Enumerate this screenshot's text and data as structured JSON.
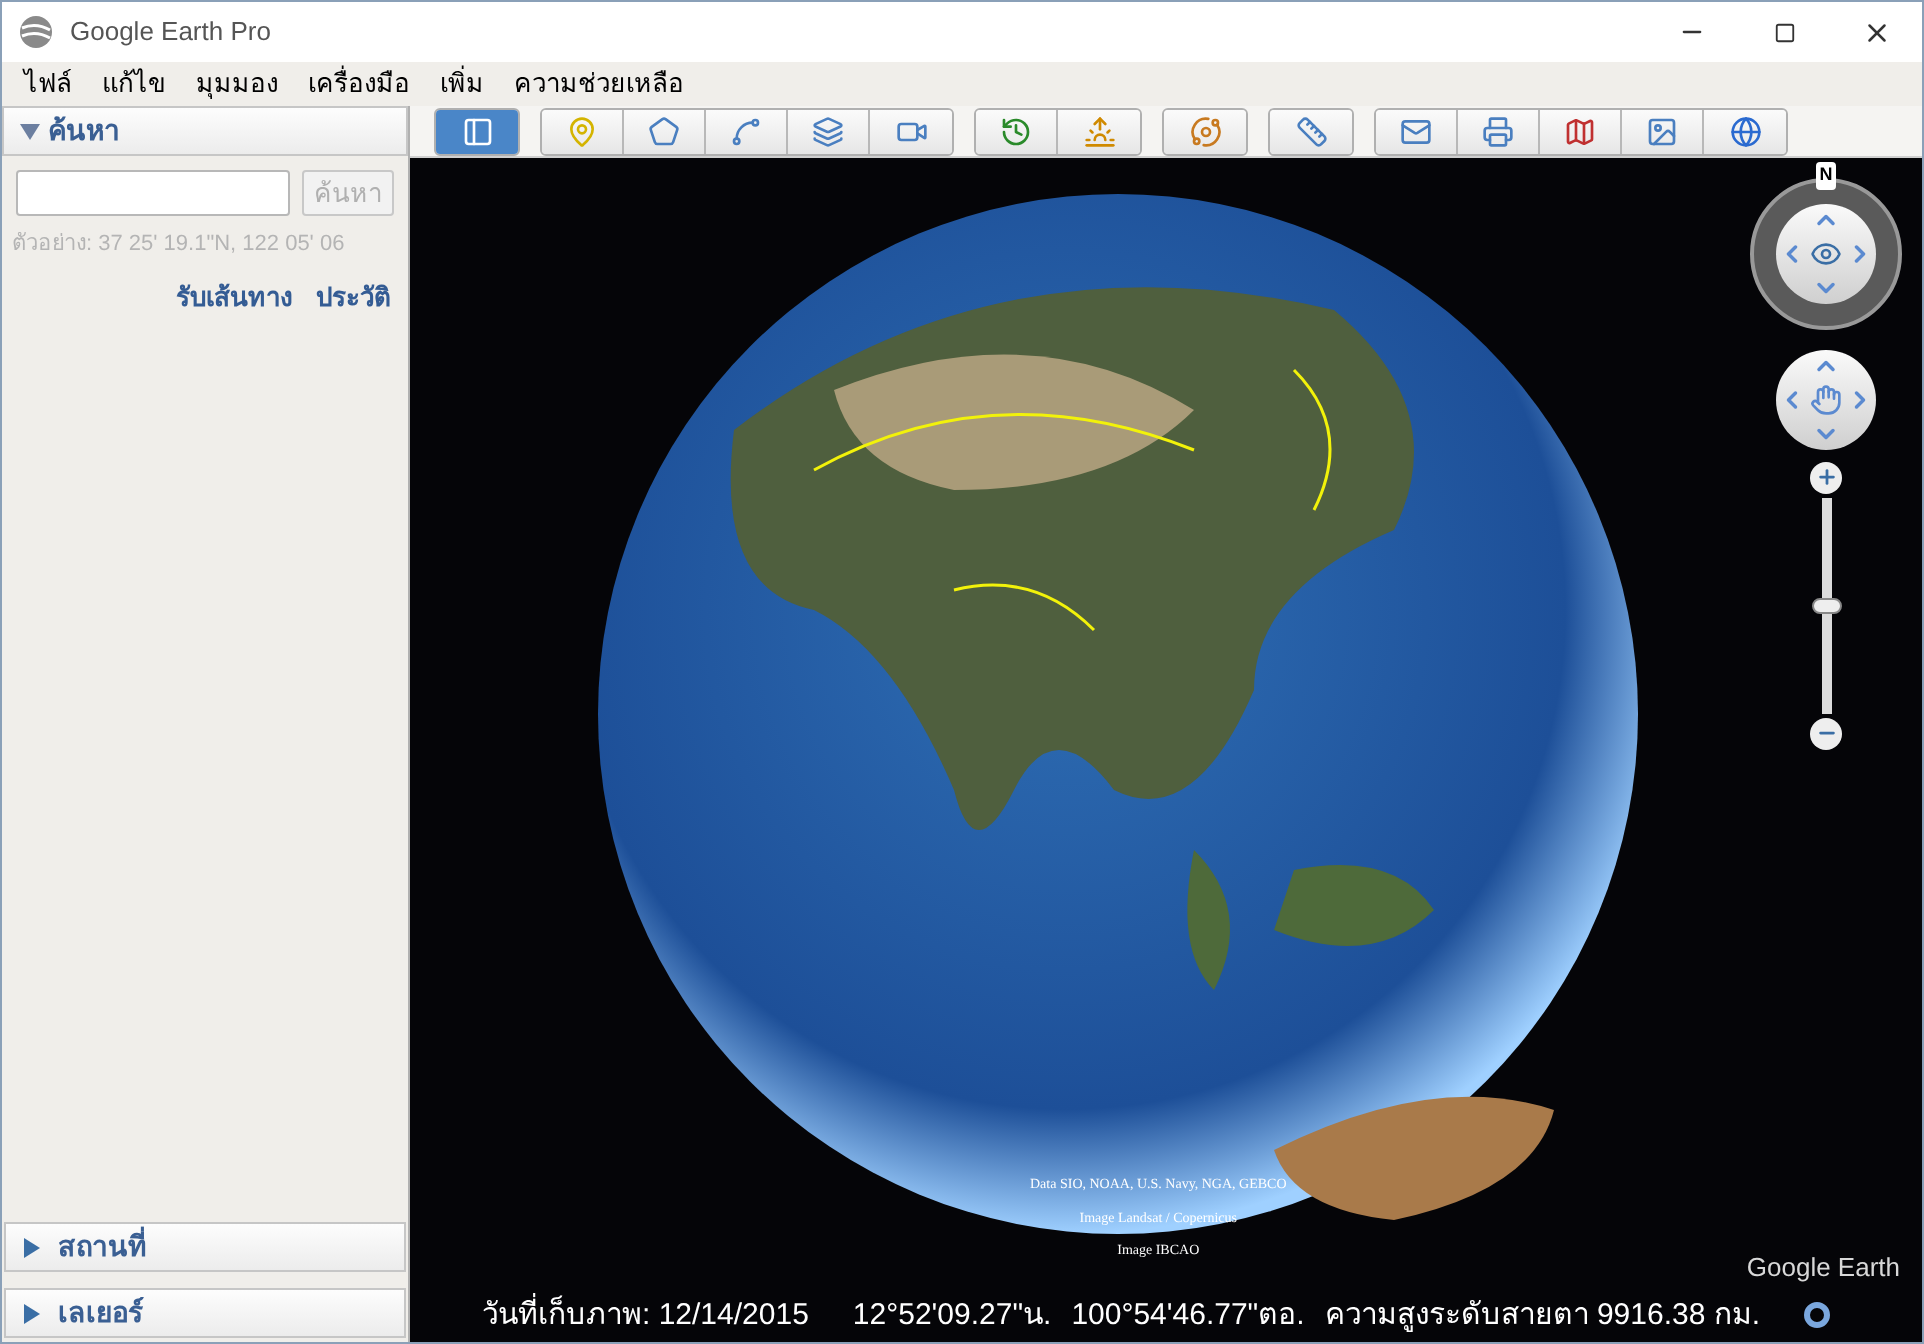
{
  "window": {
    "title": "Google Earth Pro"
  },
  "menu": [
    "ไฟล์",
    "แก้ไข",
    "มุมมอง",
    "เครื่องมือ",
    "เพิ่ม",
    "ความช่วยเหลือ"
  ],
  "search_panel": {
    "title": "ค้นหา",
    "expanded": true,
    "button": "ค้นหา",
    "example": "ตัวอย่าง: 37 25' 19.1\"N, 122 05' 06",
    "links": [
      "รับเส้นทาง",
      "ประวัติ"
    ]
  },
  "bottom_panels": [
    {
      "title": "สถานที่",
      "expanded": false
    },
    {
      "title": "เลเยอร์",
      "expanded": false
    }
  ],
  "toolbar": {
    "groups": [
      [
        {
          "kind": "sidebar",
          "selected": true
        }
      ],
      [
        {
          "kind": "placemark",
          "selected": false
        },
        {
          "kind": "polygon",
          "selected": false
        },
        {
          "kind": "path",
          "selected": false
        },
        {
          "kind": "overlay",
          "selected": false
        },
        {
          "kind": "tour",
          "selected": false
        }
      ],
      [
        {
          "kind": "history",
          "selected": false
        },
        {
          "kind": "sun",
          "selected": false
        }
      ],
      [
        {
          "kind": "planet",
          "selected": false
        }
      ],
      [
        {
          "kind": "ruler",
          "selected": false
        }
      ],
      [
        {
          "kind": "email",
          "selected": false
        },
        {
          "kind": "print",
          "selected": false
        },
        {
          "kind": "maps",
          "selected": false
        },
        {
          "kind": "image",
          "selected": false
        },
        {
          "kind": "globe",
          "selected": false
        }
      ]
    ]
  },
  "navigation": {
    "compass": "N",
    "zoom_slider": {
      "level": 0.5
    }
  },
  "attribution": [
    "Data SIO, NOAA, U.S. Navy, NGA, GEBCO",
    "Image Landsat / Copernicus",
    "Image IBCAO"
  ],
  "logo": "Google Earth",
  "status_bar": {
    "imagery_date": "วันที่เก็บภาพ: 12/14/2015",
    "latitude": "12°52'09.27\"น.",
    "longitude": "100°54'46.77\"ตอ.",
    "eye_altitude": "ความสูงระดับสายตา 9916.38 กม."
  }
}
